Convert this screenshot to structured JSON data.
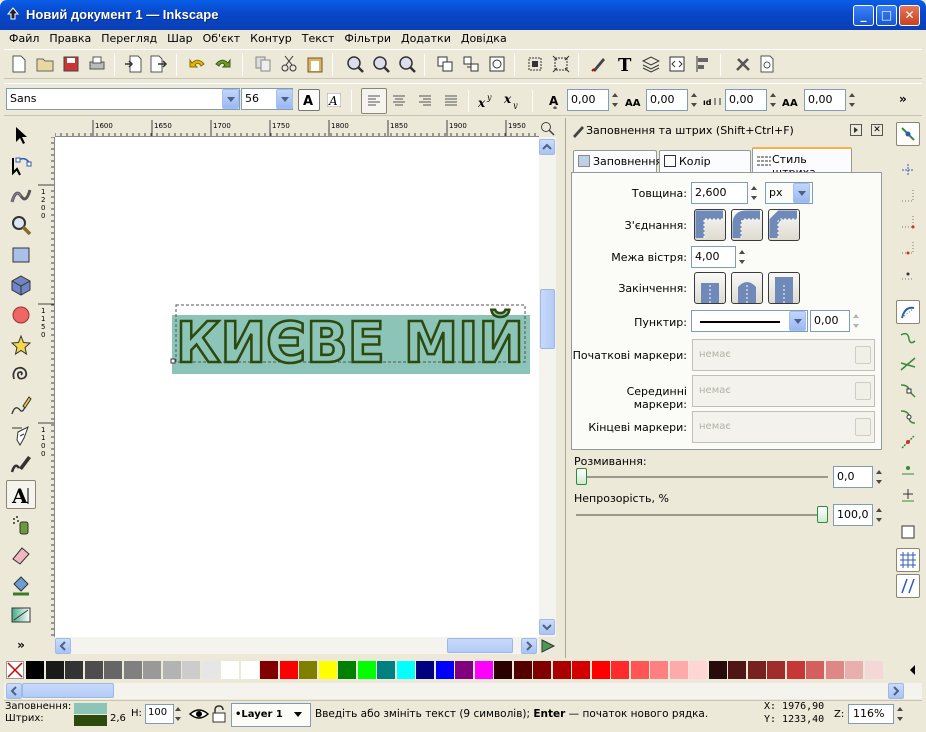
{
  "window": {
    "title": "Новий документ 1 — Inkscape",
    "min_label": "_",
    "max_label": "□",
    "close_label": "✕"
  },
  "menu": [
    "Файл",
    "Правка",
    "Перегляд",
    "Шар",
    "Об'єкт",
    "Контур",
    "Текст",
    "Фільтри",
    "Додатки",
    "Довідка"
  ],
  "text_toolbar": {
    "font_family": "Sans",
    "font_size": "56",
    "spacing1": "0,00",
    "spacing2": "0,00",
    "spacing3": "0,00",
    "spacing4": "0,00",
    "more": "»"
  },
  "ruler": {
    "h_ticks": [
      "1600",
      "1650",
      "1700",
      "1750",
      "1800",
      "1850",
      "1900",
      "1950"
    ],
    "v_ticks": [
      "1200",
      "1150",
      "1100"
    ]
  },
  "canvas_text": "КИЄВЕ МІЙ",
  "dialog": {
    "title": "Заповнення та штрих (Shift+Ctrl+F)",
    "tabs": [
      "Заповнення",
      "Колір штриха",
      "Стиль штриха"
    ],
    "width_label": "Товщина:",
    "width_value": "2,600",
    "unit": "px",
    "join_label": "З'єднання:",
    "miter_label": "Межа вістря:",
    "miter_value": "4,00",
    "cap_label": "Закінчення:",
    "dash_label": "Пунктир:",
    "dash_value": "0,00",
    "start_marker_label": "Початкові маркери:",
    "mid_marker_label": "Серединні маркери:",
    "end_marker_label": "Кінцеві маркери:",
    "marker_none": "немає",
    "blur_label": "Розмивання:",
    "blur_value": "0,0",
    "opacity_label": "Непрозорість, %",
    "opacity_value": "100,0",
    "opacity_fraction": 1.0,
    "blur_fraction": 0.0
  },
  "palette_colors": [
    "#000000",
    "#1a1a1a",
    "#333333",
    "#4d4d4d",
    "#666666",
    "#808080",
    "#999999",
    "#b3b3b3",
    "#cccccc",
    "#e6e6e6",
    "#ffffff",
    "#ffffff",
    "#800000",
    "#ff0000",
    "#808000",
    "#ffff00",
    "#008000",
    "#00ff00",
    "#008080",
    "#00ffff",
    "#000080",
    "#0000ff",
    "#800080",
    "#ff00ff",
    "#2b0000",
    "#550000",
    "#800000",
    "#aa0000",
    "#d40000",
    "#ff0000",
    "#ff2a2a",
    "#ff5555",
    "#ff8080",
    "#ffaaaa",
    "#ffd5d5",
    "#280b0b",
    "#501616",
    "#782121",
    "#a02c2c",
    "#c83737",
    "#d35f5f",
    "#de8787",
    "#e9afaf",
    "#f4d7d7"
  ],
  "status": {
    "fill_label": "Заповнення:",
    "stroke_label": "Штрих:",
    "stroke_width": "2,6",
    "fill_color": "#8cc4b8",
    "stroke_color": "#2d4a0d",
    "h_label": "Н:",
    "h_value": "100",
    "layer": "•Layer 1",
    "message_pre": "Введіть або змініть текст (9 символів); ",
    "message_key": "Enter",
    "message_post": " — початок нового рядка.",
    "x_coord": "X: 1976,90",
    "y_coord": "Y: 1233,40",
    "zoom_label": "Z:",
    "zoom_value": "116%"
  },
  "colors": {
    "text_fill": "#8cc4b8",
    "text_stroke": "#2d4a0d",
    "title_blue": "#0a54e0"
  }
}
